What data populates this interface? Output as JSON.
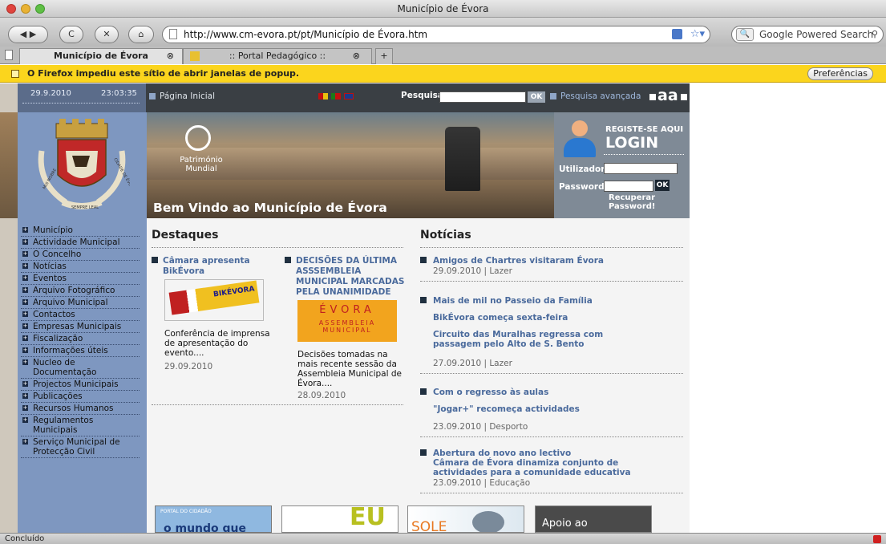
{
  "window": {
    "title": "Município de Évora"
  },
  "nav": {
    "url": "http://www.cm-evora.pt/pt/Município de Évora.htm",
    "search_placeholder": "Google Powered Search"
  },
  "tabs": [
    {
      "label": "Município de Évora",
      "active": true
    },
    {
      "label": ":: Portal Pedagógico ::",
      "active": false
    }
  ],
  "notification": {
    "text": "O Firefox impediu este sítio de abrir janelas de popup.",
    "button": "Preferências"
  },
  "site": {
    "date": "29.9.2010",
    "time": "23:03:35",
    "home_link": "Página Inicial",
    "search_label": "Pesquisa",
    "search_ok": "OK",
    "advanced_search": "Pesquisa avançada",
    "font_sizes": "aa",
    "banner_heritage": "Património Mundial",
    "banner_welcome": "Bem Vindo ao Município de Évora",
    "crest_motto_left": "MUI NOBRE",
    "crest_motto_right": "CIDADE DE ÉVORA",
    "crest_motto_bottom": "SEMPRE LEAL",
    "login": {
      "register": "REGISTE-SE AQUI",
      "title": "LOGIN",
      "user_label": "Utilizador",
      "password_label": "Password",
      "ok": "OK",
      "recover": "Recuperar Password!"
    },
    "menu": [
      "Município",
      "Actividade Municipal",
      "O Concelho",
      "Notícias",
      "Eventos",
      "Arquivo Fotográfico",
      "Arquivo Municipal",
      "Contactos",
      "Empresas Municipais",
      "Fiscalização",
      "Informações úteis",
      "Nucleo de Documentação",
      "Projectos Municipais",
      "Publicações",
      "Recursos Humanos",
      "Regulamentos Municipais",
      "Serviço Municipal de Protecção Civil"
    ],
    "destaques": {
      "heading": "Destaques",
      "item1": {
        "title": "Câmara apresenta BikÉvora",
        "image_text": "BIKÉVORA",
        "text": "Conferência de imprensa de apresentação do evento....",
        "date": "29.09.2010"
      },
      "item2": {
        "title": "DECISÕES DA ÚLTIMA ASSSEMBLEIA MUNICIPAL MARCADAS PELA UNANIMIDADE",
        "image_text_1": "ÉVORA",
        "image_text_2": "ASSEMBLEIA MUNICIPAL",
        "text": "Decisões tomadas na mais recente sessão da Assembleia Municipal de Évora....",
        "date": "28.09.2010"
      }
    },
    "noticias": {
      "heading": "Notícias",
      "items": [
        {
          "title": "Amigos de Chartres visitaram Évora",
          "meta": "29.09.2010 | Lazer"
        },
        {
          "title": "Mais de mil no Passeio da Família",
          "sub1": "BikÉvora começa sexta-feira",
          "sub2": "Circuito das Muralhas regressa com passagem pelo Alto de S. Bento",
          "meta": "27.09.2010 | Lazer"
        },
        {
          "title": "Com o regresso às aulas",
          "sub1": "\"Jogar+\" recomeça actividades",
          "meta": "23.09.2010 | Desporto"
        },
        {
          "title": "Abertura do novo ano lectivo",
          "sub1": "Câmara de Évora dinamiza conjunto de actividades para a comunidade educativa",
          "meta": "23.09.2010 | Educação"
        }
      ]
    },
    "bottom_banners": [
      "PORTAL DO CIDADÃO",
      "o mundo que",
      "EU",
      "SOLE",
      "Apoio ao"
    ]
  },
  "status": {
    "text": "Concluído"
  },
  "colors": {
    "sidebar": "#7e97c0",
    "link": "#4a6a9c",
    "notification": "#fbd51d"
  }
}
